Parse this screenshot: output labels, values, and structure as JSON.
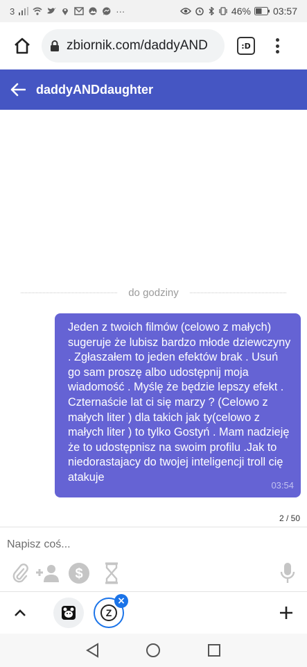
{
  "status_bar": {
    "carrier": "3",
    "battery": "46%",
    "time": "03:57"
  },
  "browser": {
    "url": "zbiornik.com/daddyAND",
    "tabs_label": ":D"
  },
  "header": {
    "title": "daddyANDdaughter"
  },
  "conversation": {
    "divider_label": "do godziny",
    "message": {
      "text": "Jeden z twoich filmów (celowo z małych) sugeruje że lubisz bardzo młode dziewczyny . Zgłaszałem to jeden efektów brak . Usuń go sam proszę albo udostępnij moja wiadomość . Myślę że będzie lepszy efekt . Czternaście lat ci się marzy ? (Celowo z małych liter ) dla takich jak ty(celowo z małych liter ) to tylko Gostyń . Mam nadzieję że to udostępnisz na swoim profilu .Jak to niedorastajacy do twojej inteligencji troll cię atakuje",
      "time": "03:54"
    },
    "char_counter": "2 / 50"
  },
  "composer": {
    "placeholder": "Napisz coś...",
    "icons": [
      "paperclip-icon",
      "add-user-icon",
      "dollar-icon",
      "hourglass-icon",
      "microphone-icon"
    ]
  },
  "tab_strip": {
    "tab2_letter": "Z"
  },
  "colors": {
    "header_bg": "#4556c3",
    "bubble_bg": "#6563d4",
    "accent_blue": "#1a73e8"
  }
}
